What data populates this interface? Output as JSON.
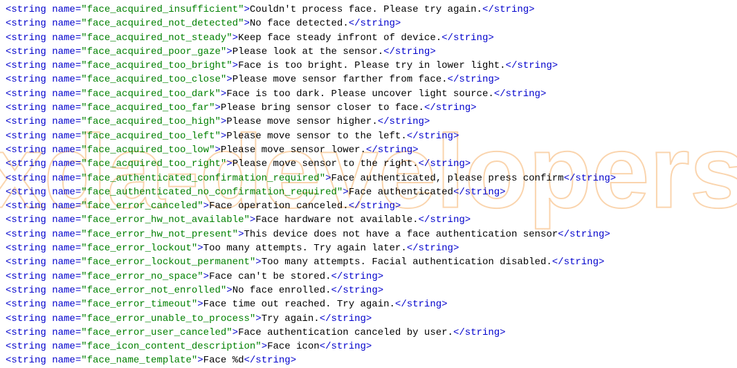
{
  "strings": [
    {
      "name": "face_acquired_insufficient",
      "value": "Couldn't process face. Please try again."
    },
    {
      "name": "face_acquired_not_detected",
      "value": "No face detected."
    },
    {
      "name": "face_acquired_not_steady",
      "value": "Keep face steady infront of device."
    },
    {
      "name": "face_acquired_poor_gaze",
      "value": "Please look at the sensor."
    },
    {
      "name": "face_acquired_too_bright",
      "value": "Face is too bright. Please try in lower light."
    },
    {
      "name": "face_acquired_too_close",
      "value": "Please move sensor farther from face."
    },
    {
      "name": "face_acquired_too_dark",
      "value": "Face is too dark. Please uncover light source."
    },
    {
      "name": "face_acquired_too_far",
      "value": "Please bring sensor closer to face."
    },
    {
      "name": "face_acquired_too_high",
      "value": "Please move sensor higher."
    },
    {
      "name": "face_acquired_too_left",
      "value": "Please move sensor to the left."
    },
    {
      "name": "face_acquired_too_low",
      "value": "Please move sensor lower."
    },
    {
      "name": "face_acquired_too_right",
      "value": "Please move sensor to the right."
    },
    {
      "name": "face_authenticated_confirmation_required",
      "value": "Face authenticated, please press confirm"
    },
    {
      "name": "face_authenticated_no_confirmation_required",
      "value": "Face authenticated"
    },
    {
      "name": "face_error_canceled",
      "value": "Face operation canceled."
    },
    {
      "name": "face_error_hw_not_available",
      "value": "Face hardware not available."
    },
    {
      "name": "face_error_hw_not_present",
      "value": "This device does not have a face authentication sensor"
    },
    {
      "name": "face_error_lockout",
      "value": "Too many attempts. Try again later."
    },
    {
      "name": "face_error_lockout_permanent",
      "value": "Too many attempts. Facial authentication disabled."
    },
    {
      "name": "face_error_no_space",
      "value": "Face can't be stored."
    },
    {
      "name": "face_error_not_enrolled",
      "value": "No face enrolled."
    },
    {
      "name": "face_error_timeout",
      "value": "Face time out reached. Try again."
    },
    {
      "name": "face_error_unable_to_process",
      "value": "Try again."
    },
    {
      "name": "face_error_user_canceled",
      "value": "Face authentication canceled by user."
    },
    {
      "name": "face_icon_content_description",
      "value": "Face icon"
    },
    {
      "name": "face_name_template",
      "value": "Face %d"
    }
  ],
  "watermark": "xda-developers"
}
